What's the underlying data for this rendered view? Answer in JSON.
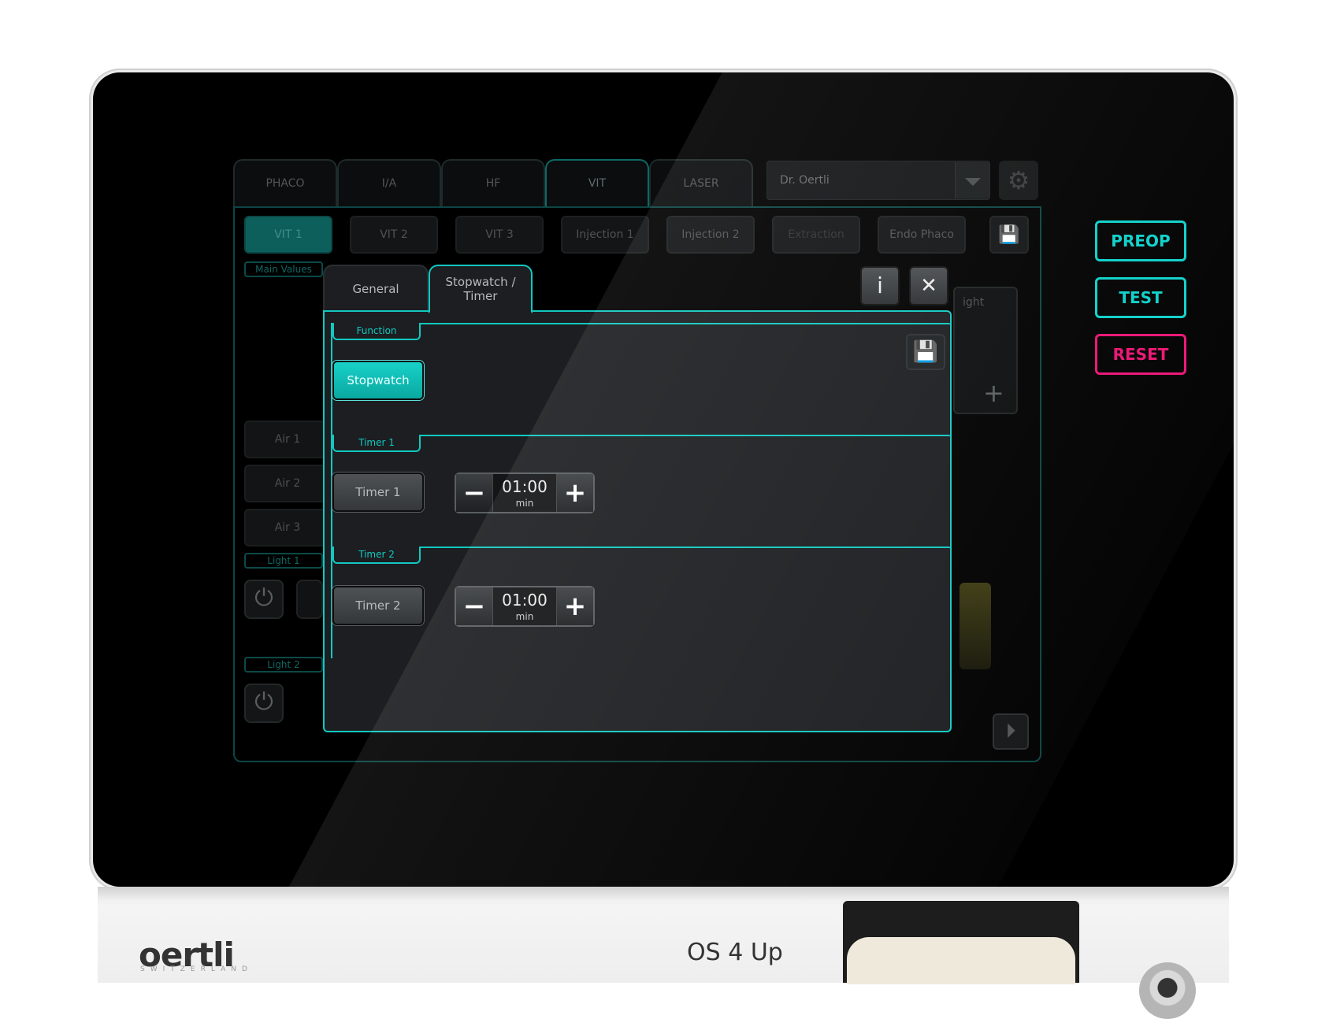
{
  "tabs": [
    {
      "label": "PHACO",
      "active": false
    },
    {
      "label": "I/A",
      "active": false
    },
    {
      "label": "HF",
      "active": false
    },
    {
      "label": "VIT",
      "active": true
    },
    {
      "label": "LASER",
      "active": false
    }
  ],
  "profile": {
    "name": "Dr. Oertli"
  },
  "subtabs": [
    {
      "label": "VIT 1",
      "active": true
    },
    {
      "label": "VIT 2"
    },
    {
      "label": "VIT 3"
    },
    {
      "label": "Injection 1"
    },
    {
      "label": "Injection 2"
    },
    {
      "label": "Extraction"
    },
    {
      "label": "Endo Phaco"
    }
  ],
  "background": {
    "main_values_label": "Main Values",
    "air_buttons": [
      "Air 1",
      "Air 2",
      "Air 3"
    ],
    "light1_label": "Light 1",
    "light2_label": "Light 2",
    "right_partial_label": "ight"
  },
  "modal": {
    "tab_general": "General",
    "tab_stopwatch": "Stopwatch / Timer",
    "info_label": "i",
    "close_label": "✕",
    "function_label": "Function",
    "stopwatch_button": "Stopwatch",
    "timer1_section": "Timer 1",
    "timer1_button": "Timer 1",
    "timer1_value": "01:00",
    "timer1_unit": "min",
    "timer2_section": "Timer 2",
    "timer2_button": "Timer 2",
    "timer2_value": "01:00",
    "timer2_unit": "min",
    "minus": "−",
    "plus": "+"
  },
  "hardware": {
    "preop": "PREOP",
    "test": "TEST",
    "reset": "RESET"
  },
  "branding": {
    "logo": "oertli",
    "logo_sub": "SWITZERLAND",
    "model": "OS 4 Up"
  },
  "colors": {
    "accent": "#12c8c0",
    "reset": "#ec1a78"
  }
}
